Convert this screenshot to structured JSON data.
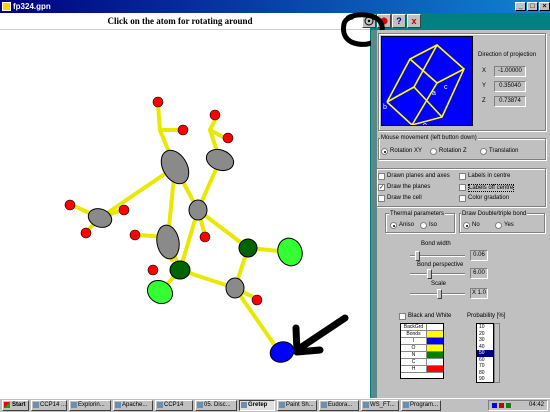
{
  "window": {
    "title": "fp324.gpn"
  },
  "toolbar": {
    "instruction": "Click on the atom for rotating around",
    "help_label": "?",
    "close_label": "x"
  },
  "projection": {
    "title": "Direction of projection",
    "x_label": "X",
    "x_value": "-1.00000",
    "y_label": "Y",
    "y_value": "0.35040",
    "z_label": "Z",
    "z_value": "0.73874",
    "cell_labels": {
      "a": "a",
      "b": "b",
      "c": "c",
      "o": "o"
    }
  },
  "mouse_movement": {
    "title": "Mouse movement (left button down)",
    "options": [
      "Rotation XY",
      "Rotation Z",
      "Translation"
    ],
    "selected": 0
  },
  "options": {
    "draw_planes_and_axes": "Drawn planes and axes",
    "draw_the_planes": "Draw the planes",
    "draw_the_cell": "Draw the cell",
    "labels_in_centre": "Labels in centre",
    "labels_off_centre": "Labels off centre",
    "color_gradation": "Color gradation"
  },
  "thermal": {
    "title": "Thermal parameters",
    "aniso": "Aniso",
    "iso": "Iso"
  },
  "bonds": {
    "title": "Draw Double/triple bond",
    "no": "No",
    "yes": "Yes"
  },
  "bond_width": {
    "label": "Bond width",
    "value": "0.06"
  },
  "bond_perspective": {
    "label": "Bond perspective",
    "value": "6.00"
  },
  "scale": {
    "label": "Scale",
    "value": "X 1.0"
  },
  "black_and_white": "Black and White",
  "probability": {
    "label": "Probability [%]",
    "values": [
      "10",
      "20",
      "30",
      "40",
      "50",
      "60",
      "70",
      "80",
      "90"
    ],
    "selected": "50"
  },
  "color_table": {
    "rows": [
      {
        "name": "BackGrd",
        "color": "#ffffff"
      },
      {
        "name": "Bonds",
        "color": "#ffff00"
      },
      {
        "name": "I",
        "color": "#0000ff"
      },
      {
        "name": "O",
        "color": "#ffff00"
      },
      {
        "name": "N",
        "color": "#008000"
      },
      {
        "name": "C",
        "color": "#ffffff"
      },
      {
        "name": "H",
        "color": "#ff0000"
      }
    ]
  },
  "taskbar": {
    "start": "Start",
    "tasks": [
      "CCP14 ...",
      "Explorin...",
      "Apache...",
      "CCP14",
      "05. Disc...",
      "Gretep",
      "Paint Sh...",
      "Eudora...",
      "WS_FT...",
      "Program..."
    ],
    "active": 5,
    "clock": "04:42"
  },
  "colors": {
    "molecule_bond": "#ffff33",
    "atom_carbon": "#808080",
    "atom_oxygen": "#ff0000",
    "atom_nitrogen": "#006400",
    "atom_chlorine": "#33ff33",
    "atom_iodine": "#0000ff"
  }
}
